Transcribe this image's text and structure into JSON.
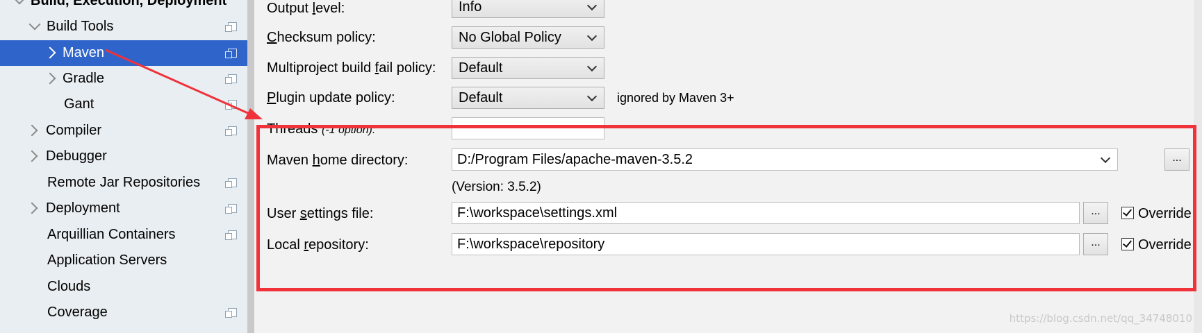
{
  "sidebar": {
    "items": [
      {
        "label": "Build, Execution, Deployment",
        "expanded": true
      },
      {
        "label": "Build Tools",
        "expanded": true
      },
      {
        "label": "Maven",
        "selected": true
      },
      {
        "label": "Gradle"
      },
      {
        "label": "Gant"
      },
      {
        "label": "Compiler"
      },
      {
        "label": "Debugger"
      },
      {
        "label": "Remote Jar Repositories"
      },
      {
        "label": "Deployment"
      },
      {
        "label": "Arquillian Containers"
      },
      {
        "label": "Application Servers"
      },
      {
        "label": "Clouds"
      },
      {
        "label": "Coverage"
      }
    ]
  },
  "form": {
    "output_level": {
      "label_pre": "Output ",
      "label_ul": "l",
      "label_post": "evel:",
      "value": "Info"
    },
    "checksum_policy": {
      "label_pre": "",
      "label_ul": "C",
      "label_post": "hecksum policy:",
      "value": "No Global Policy"
    },
    "multiproject_policy": {
      "label_pre": "Multiproject build ",
      "label_ul": "f",
      "label_post": "ail policy:",
      "value": "Default"
    },
    "plugin_update_policy": {
      "label_pre": "",
      "label_ul": "P",
      "label_post": "lugin update policy:",
      "value": "Default",
      "note": "ignored by Maven 3+"
    },
    "threads": {
      "label": "Threads",
      "hint": "(-1 option):",
      "value": ""
    },
    "maven_home": {
      "label_pre": "Maven ",
      "label_ul": "h",
      "label_post": "ome directory:",
      "value": "D:/Program Files/apache-maven-3.5.2",
      "version": "(Version: 3.5.2)",
      "browse": "..."
    },
    "user_settings": {
      "label_pre": "User ",
      "label_ul": "s",
      "label_post": "ettings file:",
      "value": "F:\\workspace\\settings.xml",
      "browse": "...",
      "override_label": "Override",
      "override_checked": true
    },
    "local_repository": {
      "label_pre": "Local ",
      "label_ul": "r",
      "label_post": "epository:",
      "value": "F:\\workspace\\repository",
      "browse": "...",
      "override_label": "Override",
      "override_checked": true
    }
  },
  "watermark": "https://blog.csdn.net/qq_34748010",
  "colors": {
    "selection": "#2f65ca",
    "highlight": "#f0323a",
    "sidebar_bg": "#e9eef2"
  }
}
